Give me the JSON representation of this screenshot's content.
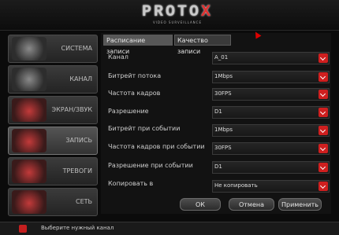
{
  "brand": {
    "logo_text": "PROTO",
    "logo_x": "X",
    "logo_subtitle": "VIDEO SURVEILLANCE"
  },
  "sidebar": {
    "items": [
      {
        "label": "СИСТЕМА",
        "icon": "gears-icon"
      },
      {
        "label": "КАНАЛ",
        "icon": "camera-icon"
      },
      {
        "label": "ЭКРАН/ЗВУК",
        "icon": "monitor-icon"
      },
      {
        "label": "ЗАПИСЬ",
        "icon": "film-reel-icon"
      },
      {
        "label": "ТРЕВОГИ",
        "icon": "alarm-icon"
      },
      {
        "label": "СЕТЬ",
        "icon": "network-globe-icon"
      }
    ],
    "active_index": 3
  },
  "tabs": [
    {
      "label": "Расписание записи",
      "active": true
    },
    {
      "label": "Качество записи",
      "active": false
    }
  ],
  "form": {
    "rows": [
      {
        "label": "Канал",
        "value": "A_01"
      },
      {
        "label": "Битрейт потока",
        "value": "1Mbps"
      },
      {
        "label": "Частота кадров",
        "value": "30FPS"
      },
      {
        "label": "Разрешение",
        "value": "D1"
      },
      {
        "label": "Битрейт при событии",
        "value": "1Mbps"
      },
      {
        "label": "Частота кадров при событии",
        "value": "30FPS"
      },
      {
        "label": "Разрешение при событии",
        "value": "D1"
      },
      {
        "label": "Копировать в",
        "value": "Не копировать"
      }
    ]
  },
  "buttons": {
    "ok": "ОК",
    "cancel": "Отмена",
    "apply": "Применить"
  },
  "status": {
    "text": "Выберите нужный канал"
  },
  "colors": {
    "accent": "#cf1f1f",
    "background": "#0b0b0b"
  }
}
